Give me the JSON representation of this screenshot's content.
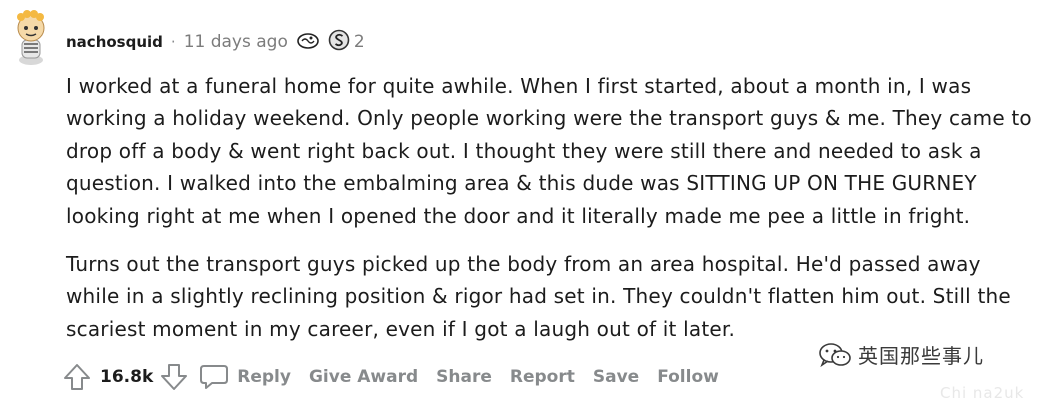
{
  "comment": {
    "username": "nachosquid",
    "separator": "·",
    "timestamp": "11 days ago",
    "award_count": "2",
    "paragraphs": [
      "I worked at a funeral home for quite awhile. When I first started, about a month in, I was working a holiday weekend. Only people working were the transport guys & me. They came to drop off a body & went right back out. I thought they were still there and needed to ask a question. I walked into the embalming area & this dude was SITTING UP ON THE GURNEY looking right at me when I opened the door and it literally made me pee a little in fright.",
      "Turns out the transport guys picked up the body from an area hospital. He'd passed away while in a slightly reclining position & rigor had set in. They couldn't flatten him out. Still the scariest moment in my career, even if I got a laugh out of it later."
    ]
  },
  "actions": {
    "score": "16.8k",
    "reply": "Reply",
    "give_award": "Give Award",
    "share": "Share",
    "report": "Report",
    "save": "Save",
    "follow": "Follow"
  },
  "watermark": {
    "text": "英国那些事儿",
    "site": "Chi na2uk"
  },
  "icons": {
    "avatar": "snoo-avatar",
    "award_1": "helpful-award-icon",
    "award_2": "silver-award-icon",
    "upvote": "upvote-arrow-icon",
    "downvote": "downvote-arrow-icon",
    "reply": "comment-bubble-icon",
    "watermark": "wechat-icon"
  }
}
